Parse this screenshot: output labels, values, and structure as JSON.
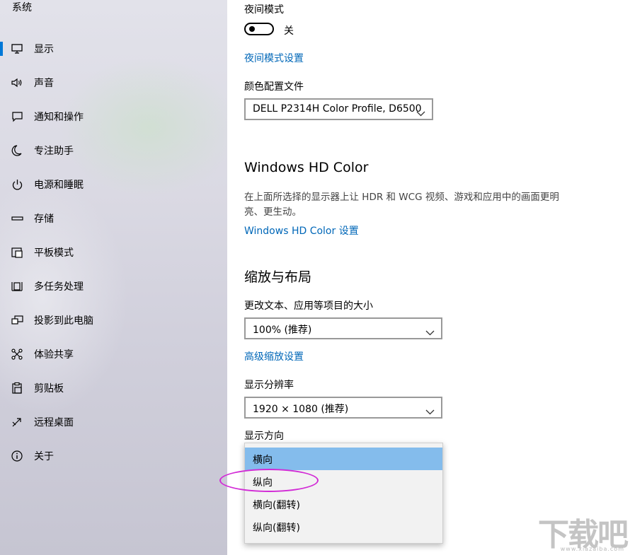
{
  "sidebar": {
    "heading": "系统",
    "items": [
      {
        "label": "显示",
        "icon": "monitor-icon",
        "selected": true
      },
      {
        "label": "声音",
        "icon": "speaker-icon"
      },
      {
        "label": "通知和操作",
        "icon": "notification-icon"
      },
      {
        "label": "专注助手",
        "icon": "moon-icon"
      },
      {
        "label": "电源和睡眠",
        "icon": "power-icon"
      },
      {
        "label": "存储",
        "icon": "storage-icon"
      },
      {
        "label": "平板模式",
        "icon": "tablet-mode-icon"
      },
      {
        "label": "多任务处理",
        "icon": "multitasking-icon"
      },
      {
        "label": "投影到此电脑",
        "icon": "project-icon"
      },
      {
        "label": "体验共享",
        "icon": "shared-experiences-icon"
      },
      {
        "label": "剪贴板",
        "icon": "clipboard-icon"
      },
      {
        "label": "远程桌面",
        "icon": "remote-desktop-icon"
      },
      {
        "label": "关于",
        "icon": "info-icon"
      }
    ]
  },
  "content": {
    "night_mode": {
      "label": "夜间模式",
      "toggle_state": "关",
      "settings_link": "夜间模式设置"
    },
    "color_profile": {
      "label": "颜色配置文件",
      "value": "DELL P2314H Color Profile, D6500"
    },
    "hd_color": {
      "heading": "Windows HD Color",
      "description": "在上面所选择的显示器上让 HDR 和 WCG 视频、游戏和应用中的画面更明亮、更生动。",
      "link": "Windows HD Color 设置"
    },
    "scale_layout": {
      "heading": "缩放与布局",
      "scale_label": "更改文本、应用等项目的大小",
      "scale_value": "100% (推荐)",
      "advanced_link": "高级缩放设置",
      "resolution_label": "显示分辨率",
      "resolution_value": "1920 × 1080 (推荐)",
      "orientation_label": "显示方向",
      "orientation_options": [
        "横向",
        "纵向",
        "横向(翻转)",
        "纵向(翻转)"
      ],
      "orientation_selected": "横向"
    }
  },
  "watermark": {
    "big": "下载吧",
    "small": "www.xiazaiba.com"
  },
  "colors": {
    "accent": "#0078d7",
    "link": "#0067b8",
    "dropdown_selected": "#84bcec",
    "annotation": "#d22bd6"
  }
}
